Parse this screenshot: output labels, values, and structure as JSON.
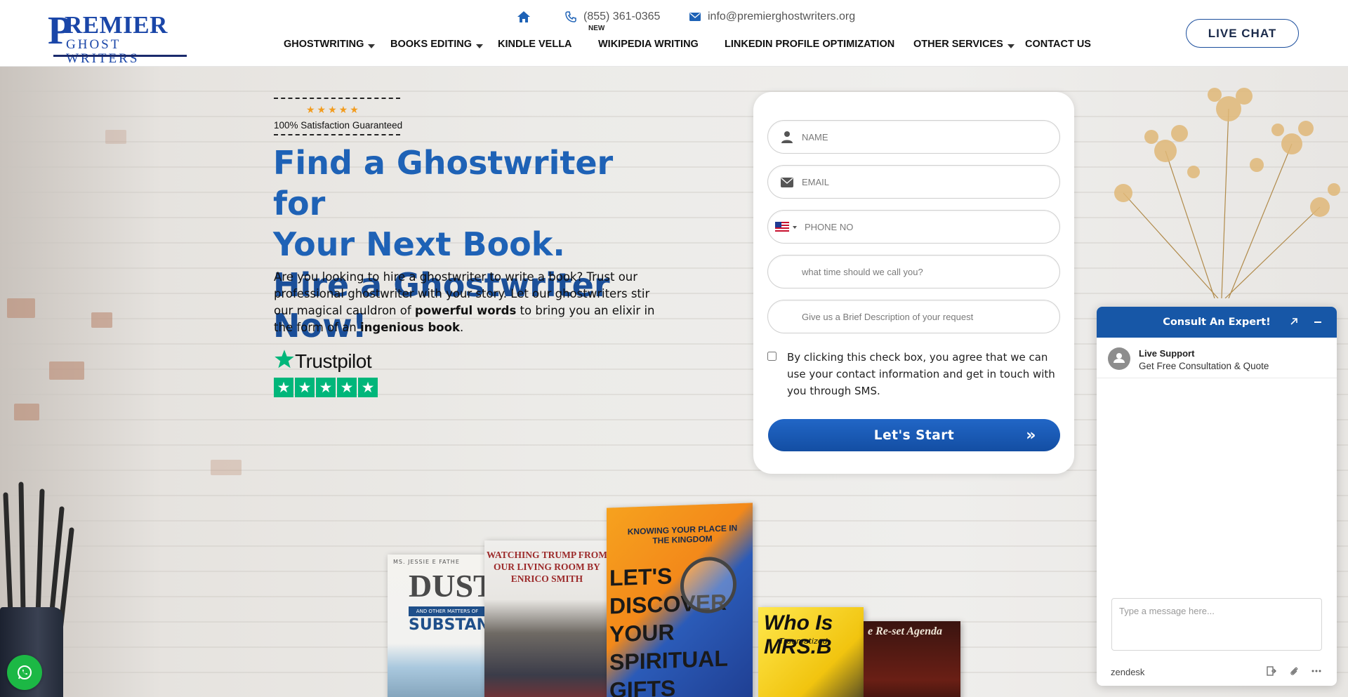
{
  "brand": {
    "logo_initial": "P",
    "logo_line1": "REMIER",
    "logo_line2": "GHOST WRITERS",
    "primary_color": "#1e62b6",
    "accent_color": "#1757a7"
  },
  "topbar": {
    "phone": "(855) 361-0365",
    "email": "info@premierghostwriters.org",
    "new_tag": "NEW"
  },
  "nav": {
    "items": [
      {
        "label": "GHOSTWRITING",
        "has_dropdown": true
      },
      {
        "label": "BOOKS EDITING",
        "has_dropdown": true
      },
      {
        "label": "KINDLE VELLA",
        "has_dropdown": false
      },
      {
        "label": "WIKIPEDIA WRITING",
        "has_dropdown": false
      },
      {
        "label": "LINKEDIN PROFILE OPTIMIZATION",
        "has_dropdown": false
      },
      {
        "label": "OTHER SERVICES",
        "has_dropdown": true
      },
      {
        "label": "CONTACT US",
        "has_dropdown": false
      }
    ],
    "live_chat_label": "LIVE CHAT"
  },
  "hero": {
    "stars": "★★★★★",
    "satisfaction": "100% Satisfaction Guaranteed",
    "headline_line1": "Find a Ghostwriter for",
    "headline_line2": "Your Next Book.",
    "headline_line3": "Hire a Ghostwriter Now!",
    "intro_part1": "Are you looking to hire a ghostwriter to write a book? Trust our professional ghostwriter with your story. Let our ghostwriters stir our magical cauldron of ",
    "intro_bold1": "powerful words",
    "intro_part2": " to bring you an elixir in the form of an ",
    "intro_bold2": "ingenious book",
    "intro_part3": ".",
    "trustpilot_label": "Trustpilot",
    "trustpilot_stars": 5
  },
  "form": {
    "name_placeholder": "NAME",
    "email_placeholder": "EMAIL",
    "phone_placeholder": "PHONE NO",
    "time_placeholder": "what time should we call you?",
    "desc_placeholder": "Give us a Brief Description of your request",
    "consent_text": "By clicking this check box, you agree that we can use your contact information and get in touch with you through SMS.",
    "submit_label": "Let's Start",
    "submit_icon": "»"
  },
  "books": {
    "b1_author": "MS. JESSIE E FATHE",
    "b1_title": "DUST",
    "b1_subtitle": "AND OTHER MATTERS OF",
    "b1_title2": "SUBSTANCE",
    "b2_title": "WATCHING TRUMP FROM OUR LIVING ROOM BY ENRICO SMITH",
    "b3_kicker": "KNOWING YOUR PLACE IN THE KINGDOM",
    "b3_title": "LET'S DISCOVER YOUR SPIRITUAL GIFTS",
    "b4_title": "Who Is MRS.B",
    "b4_subtitle": "Traumatized",
    "b5_title": "e Re-set Agenda"
  },
  "chat_widget": {
    "header_title": "Consult An Expert!",
    "agent_name": "Live Support",
    "agent_subtitle": "Get Free Consultation & Quote",
    "message_placeholder": "Type a message here...",
    "brand": "zendesk"
  }
}
